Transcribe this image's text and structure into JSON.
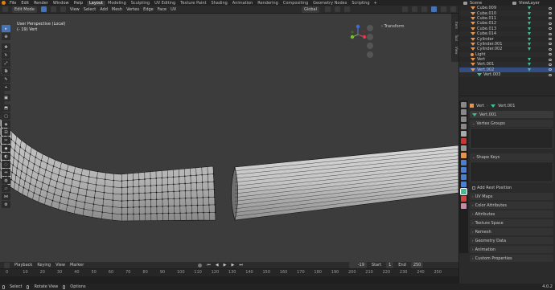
{
  "topbar": {
    "menus": [
      "File",
      "Edit",
      "Render",
      "Window",
      "Help"
    ],
    "workspaces": [
      "Layout",
      "Modeling",
      "Sculpting",
      "UV Editing",
      "Texture Paint",
      "Shading",
      "Animation",
      "Rendering",
      "Compositing",
      "Geometry Nodes",
      "Scripting"
    ],
    "active_workspace": "Layout",
    "scene_label": "Scene",
    "view_layer_label": "ViewLayer"
  },
  "viewport_header": {
    "mode": "Edit Mode",
    "menus": [
      "View",
      "Select",
      "Add",
      "Mesh",
      "Vertex",
      "Edge",
      "Face",
      "UV"
    ],
    "transform_orientation": "Global"
  },
  "viewport": {
    "view_name": "User Perspective (Local)",
    "object_info": "(- 19) Vert",
    "transform_panel": "Transform",
    "sidebar_tabs": [
      "Item",
      "Tool",
      "View"
    ]
  },
  "outliner": {
    "items": [
      {
        "name": "Cube.009",
        "icon": "mesh-icon"
      },
      {
        "name": "Cube.010",
        "icon": "mesh-icon"
      },
      {
        "name": "Cube.011",
        "icon": "mesh-icon"
      },
      {
        "name": "Cube.012",
        "icon": "mesh-icon"
      },
      {
        "name": "Cube.013",
        "icon": "mesh-icon"
      },
      {
        "name": "Cube.014",
        "icon": "mesh-icon"
      },
      {
        "name": "Cylinder",
        "icon": "mesh-icon"
      },
      {
        "name": "Cylinder.001",
        "icon": "mesh-icon"
      },
      {
        "name": "Cylinder.002",
        "icon": "mesh-icon"
      },
      {
        "name": "Light",
        "icon": "light-icon"
      },
      {
        "name": "Vert",
        "icon": "mesh-icon"
      },
      {
        "name": "Vert.001",
        "icon": "mesh-icon"
      },
      {
        "name": "Vert.002",
        "icon": "mesh-icon"
      },
      {
        "name": "Vert.003",
        "icon": "mesh-data-icon"
      }
    ]
  },
  "properties": {
    "breadcrumb_object": "Vert",
    "breadcrumb_data": "Vert.001",
    "data_name_field": "Vert.001",
    "sections": {
      "vertex_groups": "Vertex Groups",
      "shape_keys": "Shape Keys",
      "add_rest_position": "Add Rest Position",
      "uv_maps": "UV Maps",
      "color_attributes": "Color Attributes",
      "attributes": "Attributes",
      "texture_space": "Texture Space",
      "remesh": "Remesh",
      "geometry_data": "Geometry Data",
      "animation": "Animation",
      "custom_properties": "Custom Properties"
    }
  },
  "timeline": {
    "menus": [
      "Playback",
      "Keying",
      "View",
      "Marker"
    ],
    "current_frame": "-19",
    "start_label": "Start",
    "start_value": "1",
    "end_label": "End",
    "end_value": "250",
    "ruler_ticks": [
      "0",
      "10",
      "20",
      "30",
      "40",
      "50",
      "60",
      "70",
      "80",
      "90",
      "100",
      "110",
      "120",
      "130",
      "140",
      "150",
      "160",
      "170",
      "180",
      "190",
      "200",
      "210",
      "220",
      "230",
      "240",
      "250"
    ]
  },
  "statusbar": {
    "items": [
      "Select",
      "Rotate View",
      "Options"
    ],
    "version": "4.0.2"
  },
  "colors": {
    "accent": "#4772b3",
    "mesh_orange": "#e8954c",
    "data_green": "#3fbf8f",
    "viewport_bg": "#3c3c3c"
  }
}
